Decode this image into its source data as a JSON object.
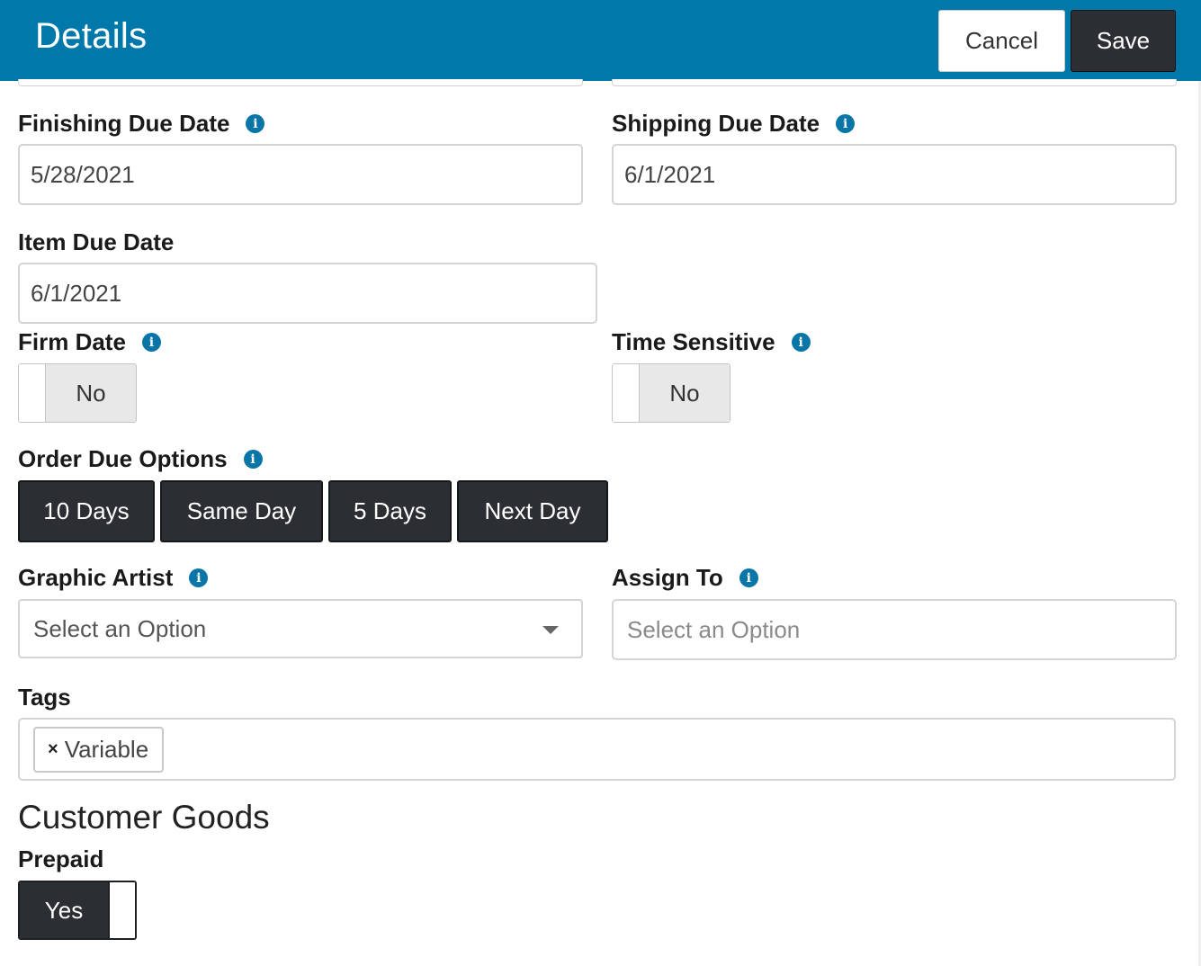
{
  "header": {
    "title": "Details",
    "cancel_label": "Cancel",
    "save_label": "Save",
    "color": "#0078aa"
  },
  "finishing_due_date": {
    "label": "Finishing Due Date",
    "value": "5/28/2021"
  },
  "shipping_due_date": {
    "label": "Shipping Due Date",
    "value": "6/1/2021"
  },
  "item_due_date": {
    "label": "Item Due Date",
    "value": "6/1/2021"
  },
  "firm_date": {
    "label": "Firm Date",
    "state": "No"
  },
  "time_sensitive": {
    "label": "Time Sensitive",
    "state": "No"
  },
  "order_due_options": {
    "label": "Order Due Options",
    "options": [
      "10 Days",
      "Same Day",
      "5 Days",
      "Next Day"
    ]
  },
  "graphic_artist": {
    "label": "Graphic Artist",
    "placeholder": "Select an Option"
  },
  "assign_to": {
    "label": "Assign To",
    "placeholder": "Select an Option"
  },
  "tags": {
    "label": "Tags",
    "items": [
      "Variable"
    ],
    "remove_symbol": "×"
  },
  "customer_goods": {
    "title": "Customer Goods",
    "prepaid": {
      "label": "Prepaid",
      "state": "Yes"
    }
  },
  "icons": {
    "info": "info-icon",
    "caret": "chevron-down-icon",
    "info_glyph": "i"
  }
}
